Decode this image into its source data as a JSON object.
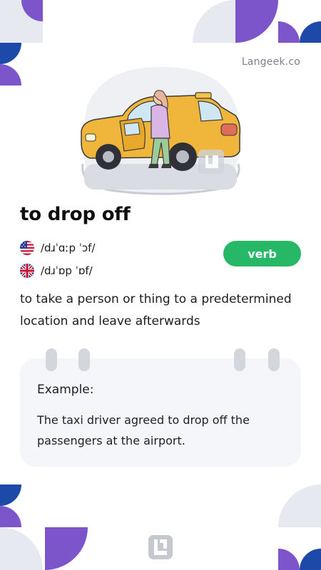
{
  "brand": "Langeek.co",
  "word": "to drop off",
  "pronunciations": [
    {
      "region": "US",
      "flag_icon": "us-flag-icon",
      "ipa": "/dɹˈɑːp ˈɔf/"
    },
    {
      "region": "UK",
      "flag_icon": "uk-flag-icon",
      "ipa": "/dɹˈɒp ˈɒf/"
    }
  ],
  "part_of_speech": "verb",
  "definition": "to take a person or thing to a predetermined location and leave afterwards",
  "example": {
    "label": "Example:",
    "sentence": "The taxi driver agreed to drop off the passengers at the airport."
  },
  "colors": {
    "accent_purple": "#7b55c9",
    "accent_blue": "#1d4aa8",
    "deco_gray": "#e6e8ef",
    "badge_green": "#26b866",
    "card_bg": "#f5f6fa"
  }
}
